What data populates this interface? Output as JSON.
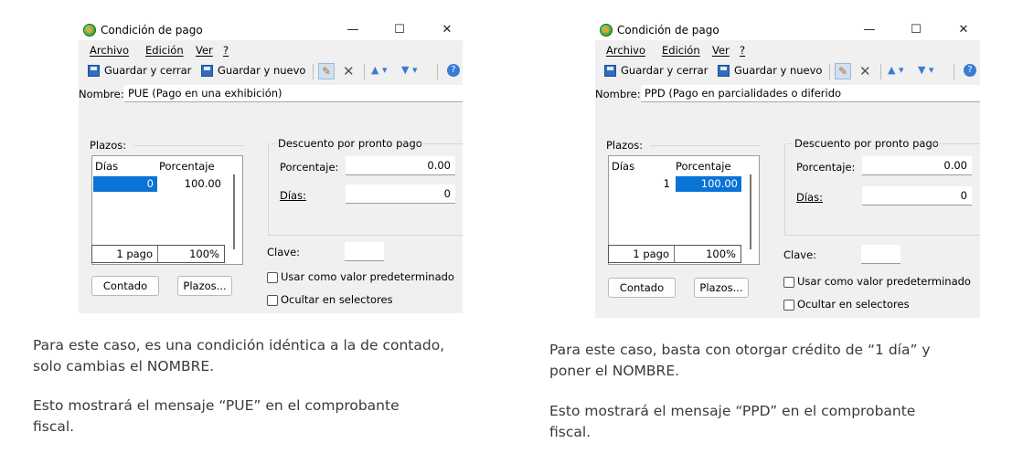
{
  "panels": [
    {
      "window": {
        "title": "Condición de pago",
        "controls": {
          "minimize": "—",
          "maximize": "☐",
          "close": "✕"
        },
        "menu": [
          "Archivo",
          "Edición",
          "Ver",
          "?"
        ],
        "toolbar": {
          "save_close": "Guardar y cerrar",
          "save_new": "Guardar y nuevo"
        },
        "name_label": "Nombre:",
        "name_value": "PUE (Pago en una exhibición)",
        "plazos_label": "Plazos:",
        "grid_headers": {
          "dias": "Días",
          "porcentaje": "Porcentaje"
        },
        "row": {
          "dias": "0",
          "porcentaje": "100.00"
        },
        "totals": {
          "pagos": "1 pago",
          "porcentaje": "100%"
        },
        "buttons": {
          "contado": "Contado",
          "plazos": "Plazos..."
        },
        "descuento_title": "Descuento por pronto pago",
        "porcentaje_label": "Porcentaje:",
        "porcentaje_value": "0.00",
        "dias_label": "Días:",
        "dias_value": "0",
        "clave_label": "Clave:",
        "clave_value": "",
        "checkbox_default": "Usar como valor predeterminado",
        "checkbox_hide": "Ocultar en selectores"
      },
      "caption": {
        "line1": "Para este caso, es una condición idéntica a la de contado,",
        "line2": "solo cambias el NOMBRE.",
        "line3": "Esto mostrará el mensaje “PUE” en el comprobante",
        "line4": "fiscal."
      }
    },
    {
      "window": {
        "title": "Condición de pago",
        "controls": {
          "minimize": "—",
          "maximize": "☐",
          "close": "✕"
        },
        "menu": [
          "Archivo",
          "Edición",
          "Ver",
          "?"
        ],
        "toolbar": {
          "save_close": "Guardar y cerrar",
          "save_new": "Guardar y nuevo"
        },
        "name_label": "Nombre:",
        "name_value": "PPD (Pago en parcialidades o diferido",
        "plazos_label": "Plazos:",
        "grid_headers": {
          "dias": "Días",
          "porcentaje": "Porcentaje"
        },
        "row": {
          "dias": "1",
          "porcentaje": "100.00"
        },
        "totals": {
          "pagos": "1 pago",
          "porcentaje": "100%"
        },
        "buttons": {
          "contado": "Contado",
          "plazos": "Plazos..."
        },
        "descuento_title": "Descuento por pronto pago",
        "porcentaje_label": "Porcentaje:",
        "porcentaje_value": "0.00",
        "dias_label": "Días:",
        "dias_value": "0",
        "clave_label": "Clave:",
        "clave_value": "",
        "checkbox_default": "Usar como valor predeterminado",
        "checkbox_hide": "Ocultar en selectores"
      },
      "caption": {
        "line1": "Para este caso, basta con otorgar crédito de “1 día” y",
        "line2": "poner el NOMBRE.",
        "line3": "Esto mostrará el mensaje “PPD” en el comprobante",
        "line4": "fiscal."
      }
    }
  ],
  "colors": {
    "selection": "#0a74d6",
    "window_bg": "#f0f0f0",
    "caption_text": "#3a3a3a"
  }
}
